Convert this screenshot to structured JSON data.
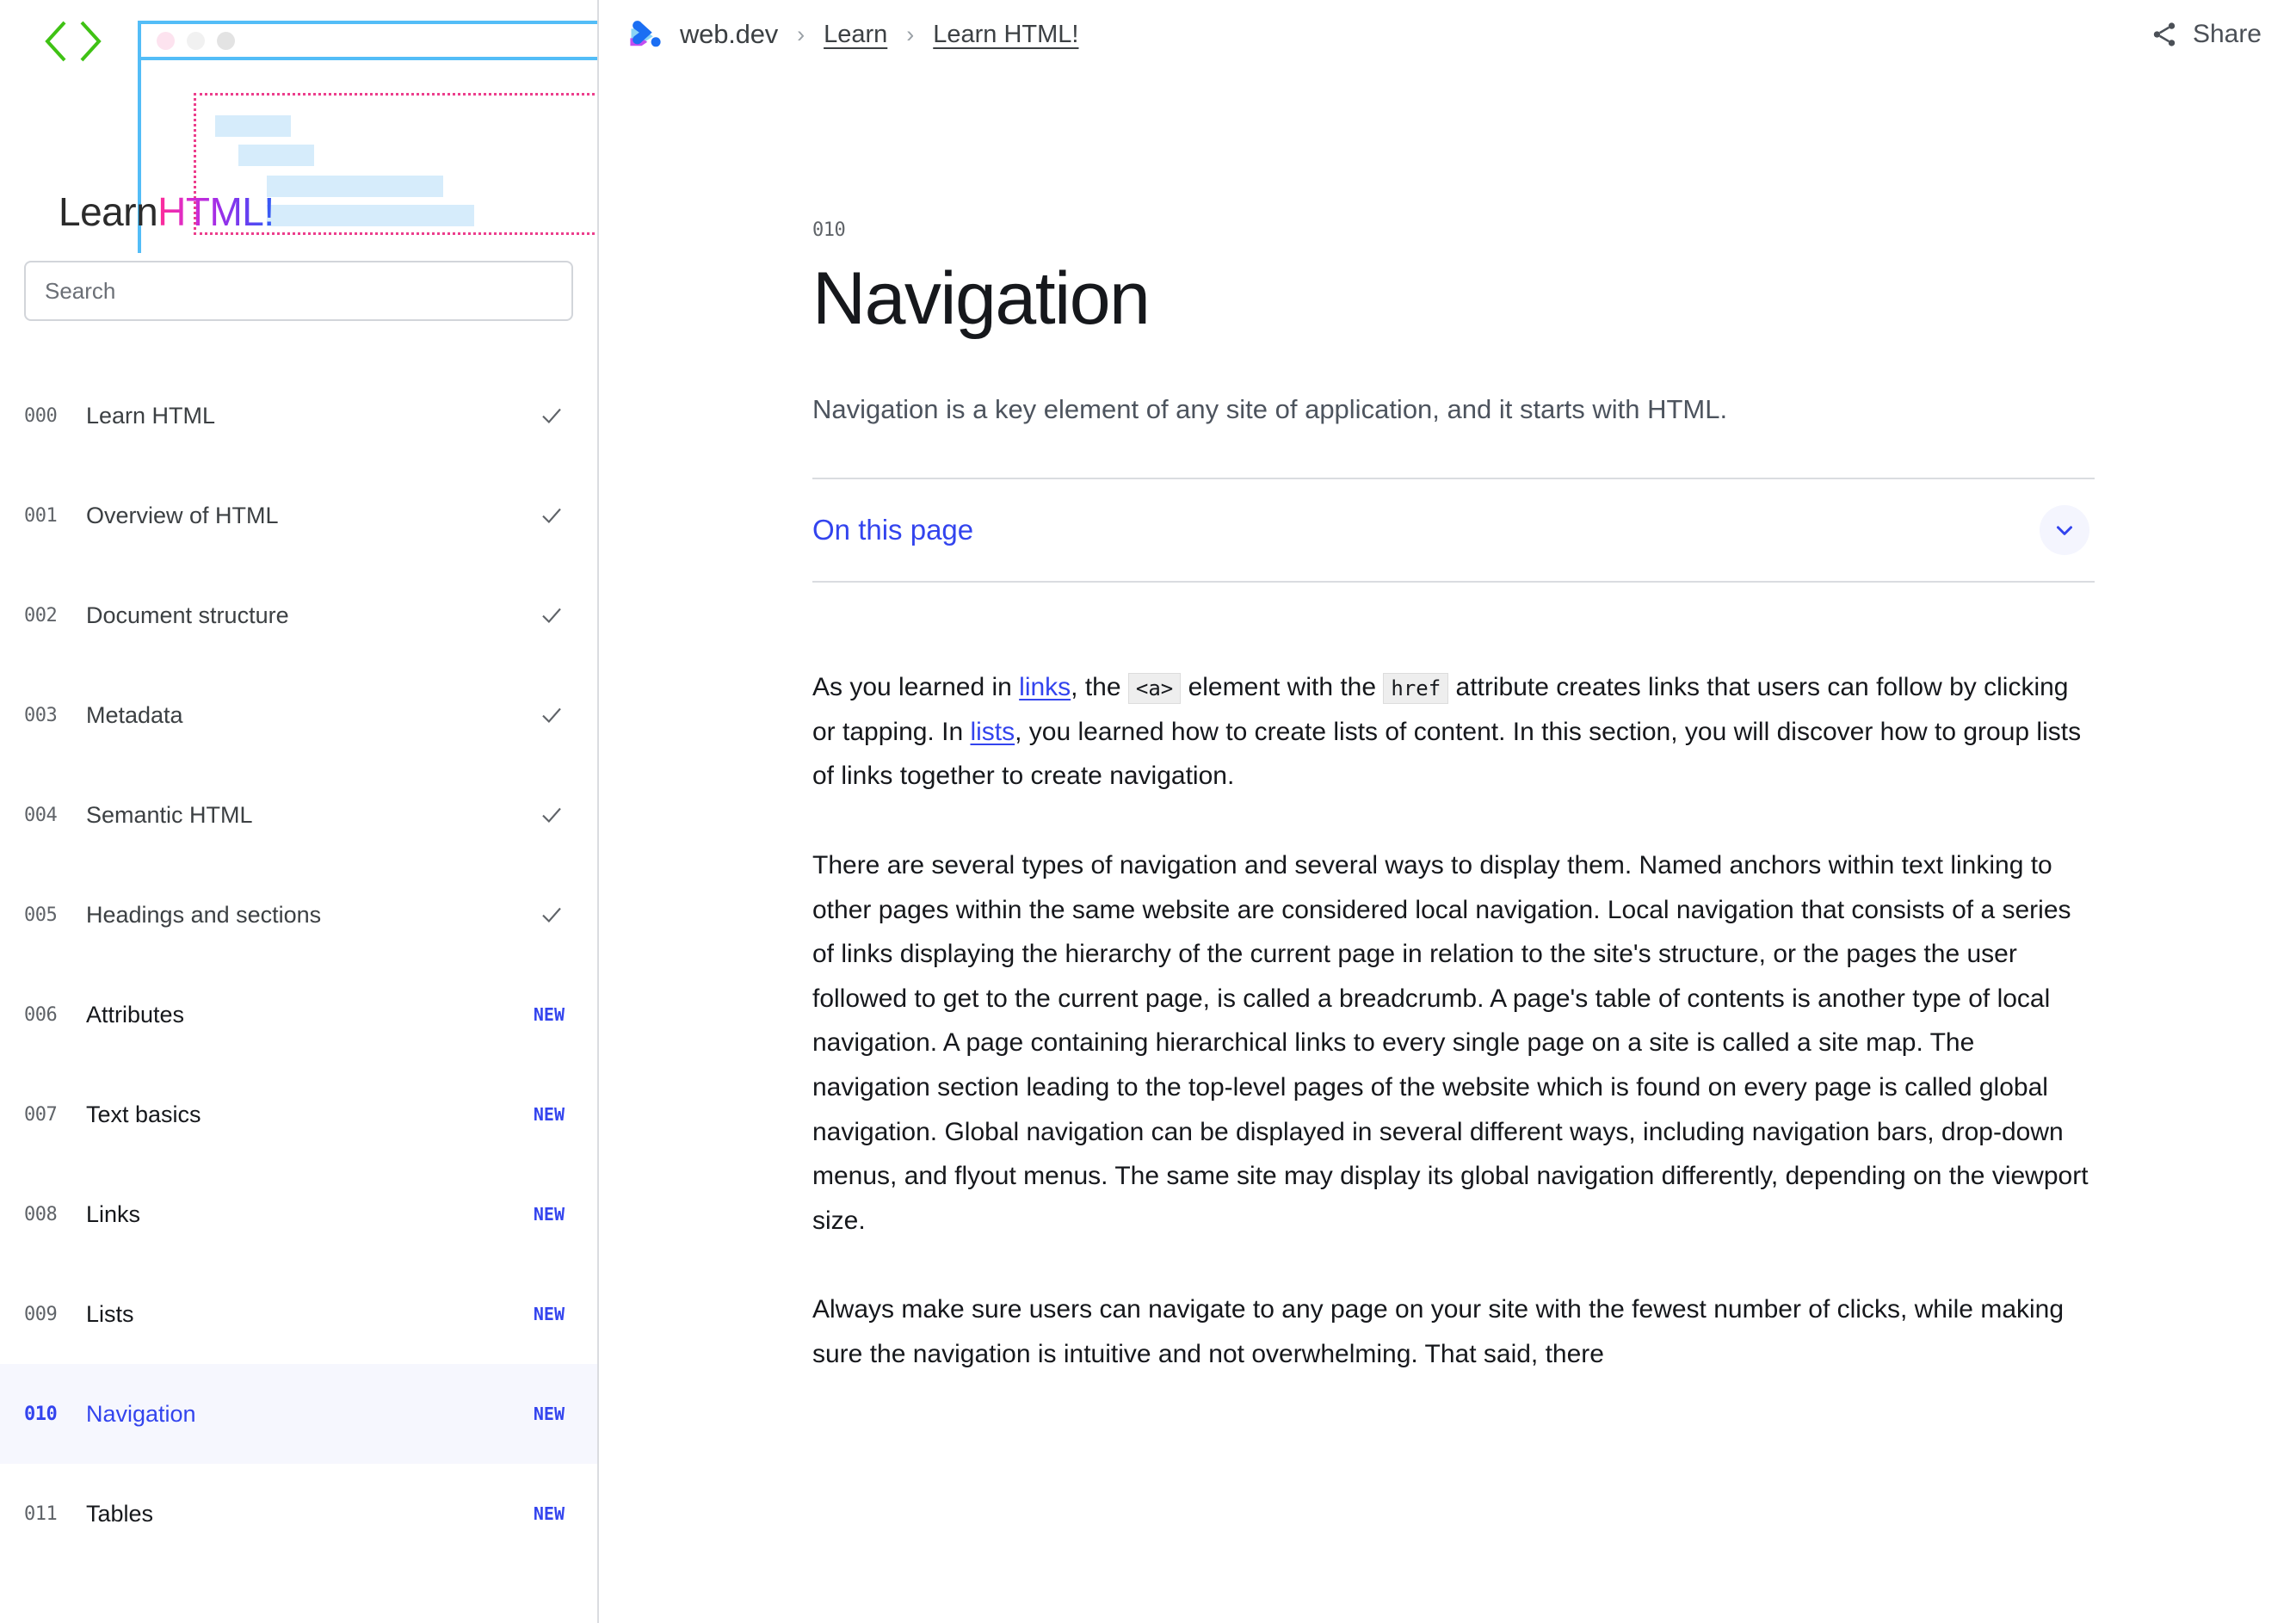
{
  "sidebar": {
    "hero": {
      "title_learn": "Learn",
      "title_html": "HTML!",
      "brackets_icon": "code-brackets-icon"
    },
    "search": {
      "placeholder": "Search",
      "value": ""
    },
    "items": [
      {
        "num": "000",
        "label": "Learn HTML",
        "status": "done"
      },
      {
        "num": "001",
        "label": "Overview of HTML",
        "status": "done"
      },
      {
        "num": "002",
        "label": "Document structure",
        "status": "done"
      },
      {
        "num": "003",
        "label": "Metadata",
        "status": "done"
      },
      {
        "num": "004",
        "label": "Semantic HTML",
        "status": "done"
      },
      {
        "num": "005",
        "label": "Headings and sections",
        "status": "done"
      },
      {
        "num": "006",
        "label": "Attributes",
        "status": "new",
        "badge": "NEW"
      },
      {
        "num": "007",
        "label": "Text basics",
        "status": "new",
        "badge": "NEW"
      },
      {
        "num": "008",
        "label": "Links",
        "status": "new",
        "badge": "NEW"
      },
      {
        "num": "009",
        "label": "Lists",
        "status": "new",
        "badge": "NEW"
      },
      {
        "num": "010",
        "label": "Navigation",
        "status": "new",
        "badge": "NEW",
        "active": true
      },
      {
        "num": "011",
        "label": "Tables",
        "status": "new",
        "badge": "NEW"
      }
    ]
  },
  "header": {
    "logo_icon": "webdev-logo-icon",
    "brand": "web.dev",
    "separator": "›",
    "breadcrumb": [
      "Learn",
      "Learn HTML!"
    ],
    "share_label": "Share",
    "share_icon": "share-icon"
  },
  "article": {
    "eyebrow": "010",
    "title": "Navigation",
    "lede": "Navigation is a key element of any site of application, and it starts with HTML.",
    "on_this_page": {
      "label": "On this page",
      "chevron_icon": "chevron-down-icon"
    },
    "p1": {
      "s1": "As you learned in ",
      "link1": "links",
      "s2": ", the ",
      "code1": "<a>",
      "s3": " element with the ",
      "code2": "href",
      "s4": " attribute creates links that users can follow by clicking or tapping. In ",
      "link2": "lists",
      "s5": ", you learned how to create lists of content. In this section, you will discover how to group lists of links together to create navigation."
    },
    "p2": "There are several types of navigation and several ways to display them. Named anchors within text linking to other pages within the same website are considered local navigation. Local navigation that consists of a series of links displaying the hierarchy of the current page in relation to the site's structure, or the pages the user followed to get to the current page, is called a breadcrumb. A page's table of contents is another type of local navigation. A page containing hierarchical links to every single page on a site is called a site map. The navigation section leading to the top-level pages of the website which is found on every page is called global navigation. Global navigation can be displayed in several different ways, including navigation bars, drop-down menus, and flyout menus. The same site may display its global navigation differently, depending on the viewport size.",
    "p3": "Always make sure users can navigate to any page on your site with the fewest number of clicks, while making sure the navigation is intuitive and not overwhelming. That said, there"
  },
  "colors": {
    "accent_blue": "#3344ee",
    "link_blue": "#3344ee",
    "text_dark": "#16181c",
    "text_muted": "#5f6368",
    "border": "#dadce0",
    "active_bg": "#f6f7fe",
    "hero_frame": "#53bdf7",
    "hero_dotted": "#ec3e8c",
    "hero_bar": "#d6ecfb",
    "brackets_green": "#3fc214"
  }
}
